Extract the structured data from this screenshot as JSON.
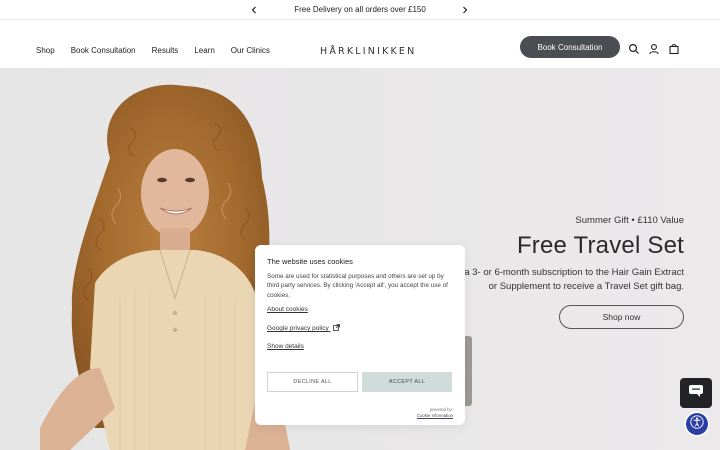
{
  "announcement": {
    "text": "Free Delivery on all orders over £150"
  },
  "header": {
    "nav": [
      "Shop",
      "Book Consultation",
      "Results",
      "Learn",
      "Our Clinics"
    ],
    "logo": "HÅRKLINIKKEN",
    "book_button": "Book Consultation",
    "icons": [
      "search-icon",
      "account-icon",
      "bag-icon"
    ]
  },
  "hero": {
    "subtitle": "Summer Gift • £110 Value",
    "title": "Free Travel Set",
    "description": "a 3- or 6-month subscription to the Hair Gain Extract or Supplement to receive a Travel Set gift bag.",
    "cta": "Shop now"
  },
  "cookie_dialog": {
    "title": "The website uses cookies",
    "body": "Some are used for statistical purposes and others are set up by third party services. By clicking 'Accept all', you accept the use of cookies.",
    "about_link": "About cookies",
    "privacy_link": "Google privacy policy",
    "details_link": "Show details",
    "decline_button": "DECLINE ALL",
    "accept_button": "ACCEPT ALL",
    "powered_by": "powered by:",
    "powered_name": "Cookie Information"
  },
  "colors": {
    "book_button_bg": "#4a4d52",
    "accept_bg": "#cfdcda",
    "hero_bg": "#e9e8e9",
    "accessibility_bg": "#2b3fa3"
  }
}
